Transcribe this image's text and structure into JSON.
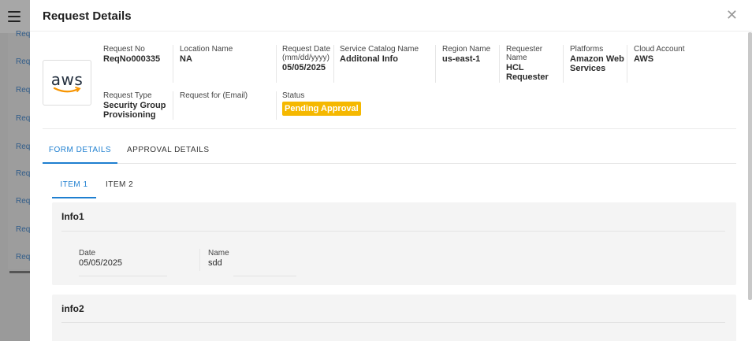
{
  "background": {
    "rows": [
      "Req",
      "Req",
      "Req",
      "Req",
      "Req",
      "Req",
      "Req",
      "Req"
    ]
  },
  "modal": {
    "title": "Request Details",
    "close_glyph": "✕",
    "logo_text": "aws"
  },
  "details": {
    "request_no": {
      "label": "Request No",
      "value": "ReqNo000335"
    },
    "location_name": {
      "label": "Location Name",
      "value": "NA"
    },
    "request_date": {
      "label": "Request Date (mm/dd/yyyy)",
      "value": "05/05/2025"
    },
    "service_catalog": {
      "label": "Service Catalog Name",
      "value": "Additonal Info"
    },
    "region_name": {
      "label": "Region Name",
      "value": "us-east-1"
    },
    "requester_name": {
      "label": "Requester Name",
      "value": "HCL Requester"
    },
    "platforms": {
      "label": "Platforms",
      "value": "Amazon Web Services"
    },
    "cloud_account": {
      "label": "Cloud Account",
      "value": "AWS"
    },
    "request_type": {
      "label": "Request Type",
      "value": "Security Group Provisioning"
    },
    "request_for": {
      "label": "Request for (Email)",
      "value": ""
    },
    "status": {
      "label": "Status",
      "value": "Pending Approval"
    }
  },
  "tabs": {
    "form_details": "FORM DETAILS",
    "approval_details": "APPROVAL DETAILS",
    "item1": "ITEM 1",
    "item2": "ITEM 2"
  },
  "cards": {
    "info1": {
      "title": "Info1",
      "date_label": "Date",
      "date_value": "05/05/2025",
      "name_label": "Name",
      "name_value": "sdd"
    },
    "info2": {
      "title": "info2"
    }
  },
  "colors": {
    "accent": "#1e7fd0",
    "status": "#f5b800"
  }
}
